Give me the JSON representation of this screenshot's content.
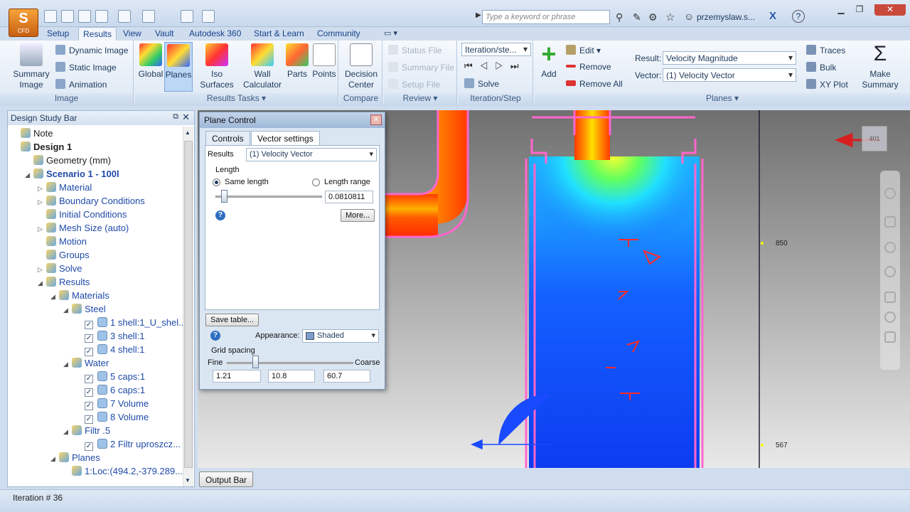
{
  "app": {
    "logo_label": "CFD"
  },
  "search": {
    "placeholder": "Type a keyword or phrase"
  },
  "user": {
    "name": "przemyslaw.s..."
  },
  "tabs": [
    "Setup",
    "Results",
    "View",
    "Vault",
    "Autodesk 360",
    "Start & Learn",
    "Community"
  ],
  "active_tab": "Results",
  "ribbon": {
    "image": {
      "label": "Image",
      "summary_image": "Summary Image",
      "dynamic_image": "Dynamic Image",
      "static_image": "Static Image",
      "animation": "Animation"
    },
    "results_tasks": {
      "label": "Results Tasks",
      "global": "Global",
      "planes": "Planes",
      "iso_surfaces": "Iso Surfaces",
      "wall_calculator": "Wall Calculator",
      "parts": "Parts",
      "points": "Points"
    },
    "compare": {
      "label": "Compare",
      "decision_center": "Decision Center"
    },
    "review": {
      "label": "Review",
      "status_file": "Status File",
      "summary_file": "Summary File",
      "setup_file": "Setup File"
    },
    "iteration_step": {
      "label": "Iteration/Step",
      "select_value": "Iteration/ste...",
      "solve": "Solve"
    },
    "planes": {
      "label": "Planes",
      "add": "Add",
      "edit": "Edit",
      "remove": "Remove",
      "remove_all": "Remove All",
      "result_label": "Result:",
      "result_value": "Velocity Magnitude",
      "vector_label": "Vector:",
      "vector_value": "(1) Velocity Vector",
      "traces": "Traces",
      "bulk": "Bulk",
      "xy_plot": "XY Plot",
      "make_summary": "Make Summary"
    }
  },
  "design_study_bar": {
    "title": "Design Study Bar",
    "items": [
      {
        "label": "Note",
        "indent": 0,
        "dark": true
      },
      {
        "label": "Design 1",
        "indent": 0,
        "dark": true,
        "bold": true
      },
      {
        "label": "Geometry (mm)",
        "indent": 1,
        "dark": true
      },
      {
        "label": "Scenario 1 - 100l",
        "indent": 1,
        "bold": true,
        "toggle": "▲"
      },
      {
        "label": "Material",
        "indent": 2,
        "toggle": "▷"
      },
      {
        "label": "Boundary Conditions",
        "indent": 2,
        "toggle": "▷"
      },
      {
        "label": "Initial Conditions",
        "indent": 2
      },
      {
        "label": "Mesh Size (auto)",
        "indent": 2,
        "toggle": "▷"
      },
      {
        "label": "Motion",
        "indent": 2
      },
      {
        "label": "Groups",
        "indent": 2
      },
      {
        "label": "Solve",
        "indent": 2,
        "toggle": "▷"
      },
      {
        "label": "Results",
        "indent": 2,
        "toggle": "▲"
      },
      {
        "label": "Materials",
        "indent": 3,
        "toggle": "▲"
      },
      {
        "label": "Steel",
        "indent": 4,
        "toggle": "▲"
      },
      {
        "label": "1 shell:1_U_shel...",
        "indent": 5,
        "check": true
      },
      {
        "label": "3 shell:1",
        "indent": 5,
        "check": true
      },
      {
        "label": "4 shell:1",
        "indent": 5,
        "check": true
      },
      {
        "label": "Water",
        "indent": 4,
        "toggle": "▲"
      },
      {
        "label": "5 caps:1",
        "indent": 5,
        "check": true
      },
      {
        "label": "6 caps:1",
        "indent": 5,
        "check": true
      },
      {
        "label": "7 Volume",
        "indent": 5,
        "check": true
      },
      {
        "label": "8 Volume",
        "indent": 5,
        "check": true
      },
      {
        "label": "Filtr .5",
        "indent": 4,
        "toggle": "▲"
      },
      {
        "label": "2 Filtr uproszcz...",
        "indent": 5,
        "check": true
      },
      {
        "label": "Planes",
        "indent": 3,
        "toggle": "▲"
      },
      {
        "label": "1:Loc:(494.2,-379.289...",
        "indent": 4
      }
    ]
  },
  "plane_control": {
    "title": "Plane Control",
    "tabs": [
      "Controls",
      "Vector settings"
    ],
    "active_tab": "Vector settings",
    "results_label": "Results",
    "results_value": "(1) Velocity Vector",
    "length_label": "Length",
    "same_length": "Same length",
    "length_range": "Length range",
    "same_length_selected": true,
    "length_value": "0.0810811",
    "length_slider_fraction": 0.05,
    "more_button": "More...",
    "save_table": "Save table...",
    "appearance_label": "Appearance:",
    "appearance_value": "Shaded",
    "grid_spacing_label": "Grid spacing",
    "fine": "Fine",
    "coarse": "Coarse",
    "grid_slider_fraction": 0.2,
    "grid_values": [
      "1.21",
      "10.8",
      "60.7"
    ]
  },
  "viewport": {
    "markers": [
      "850",
      "567"
    ],
    "viewcube": "401"
  },
  "output_bar": "Output Bar",
  "status": {
    "iteration": "Iteration # 36"
  }
}
